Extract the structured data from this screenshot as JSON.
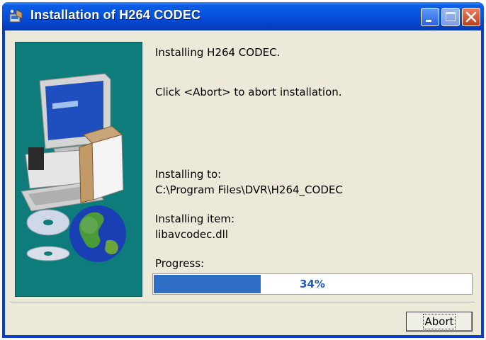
{
  "window": {
    "title": "Installation of H264 CODEC",
    "minimize_icon": "minimize-icon",
    "maximize_icon": "maximize-icon",
    "close_icon": "close-icon"
  },
  "content": {
    "line1": "Installing H264 CODEC.",
    "line2": "Click <Abort> to abort installation.",
    "installing_to_label": "Installing to:",
    "installing_to_path": "C:\\Program Files\\DVR\\H264_CODEC",
    "installing_item_label": "Installing item:",
    "installing_item_value": "libavcodec.dll",
    "progress_label": "Progress:",
    "progress_value": 34,
    "progress_text": "34%"
  },
  "buttons": {
    "abort": "Abort"
  },
  "colors": {
    "titlebar": "#0653dd",
    "panel": "#0f7c7c",
    "progress_fill": "#2f6fc6",
    "dialog_bg": "#ece9d8"
  }
}
